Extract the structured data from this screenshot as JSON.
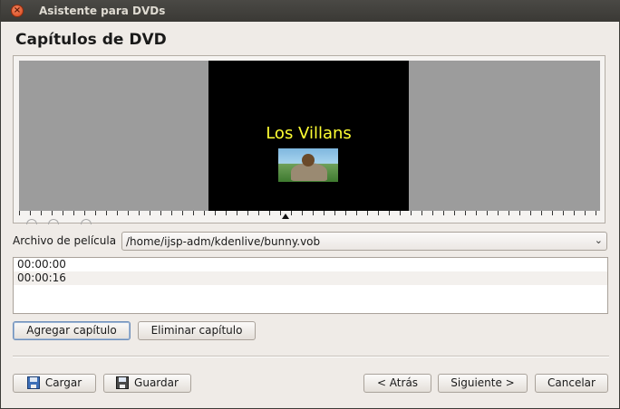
{
  "window": {
    "title": "Asistente para DVDs",
    "close_glyph": "×"
  },
  "page": {
    "heading": "Capítulos de DVD"
  },
  "preview": {
    "video_title": "Los Villans",
    "video_bg": "#000000",
    "title_color": "#ffff33"
  },
  "movie_file": {
    "label": "Archivo de película",
    "value": "/home/ijsp-adm/kdenlive/bunny.vob"
  },
  "chapters": [
    "00:00:00",
    "00:00:16"
  ],
  "buttons": {
    "add_chapter": "Agregar capítulo",
    "remove_chapter": "Eliminar capítulo",
    "load": "Cargar",
    "save": "Guardar",
    "back": "< Atrás",
    "next": "Siguiente >",
    "cancel": "Cancelar"
  },
  "icons": {
    "load": "document-open-icon",
    "save": "document-save-icon"
  }
}
